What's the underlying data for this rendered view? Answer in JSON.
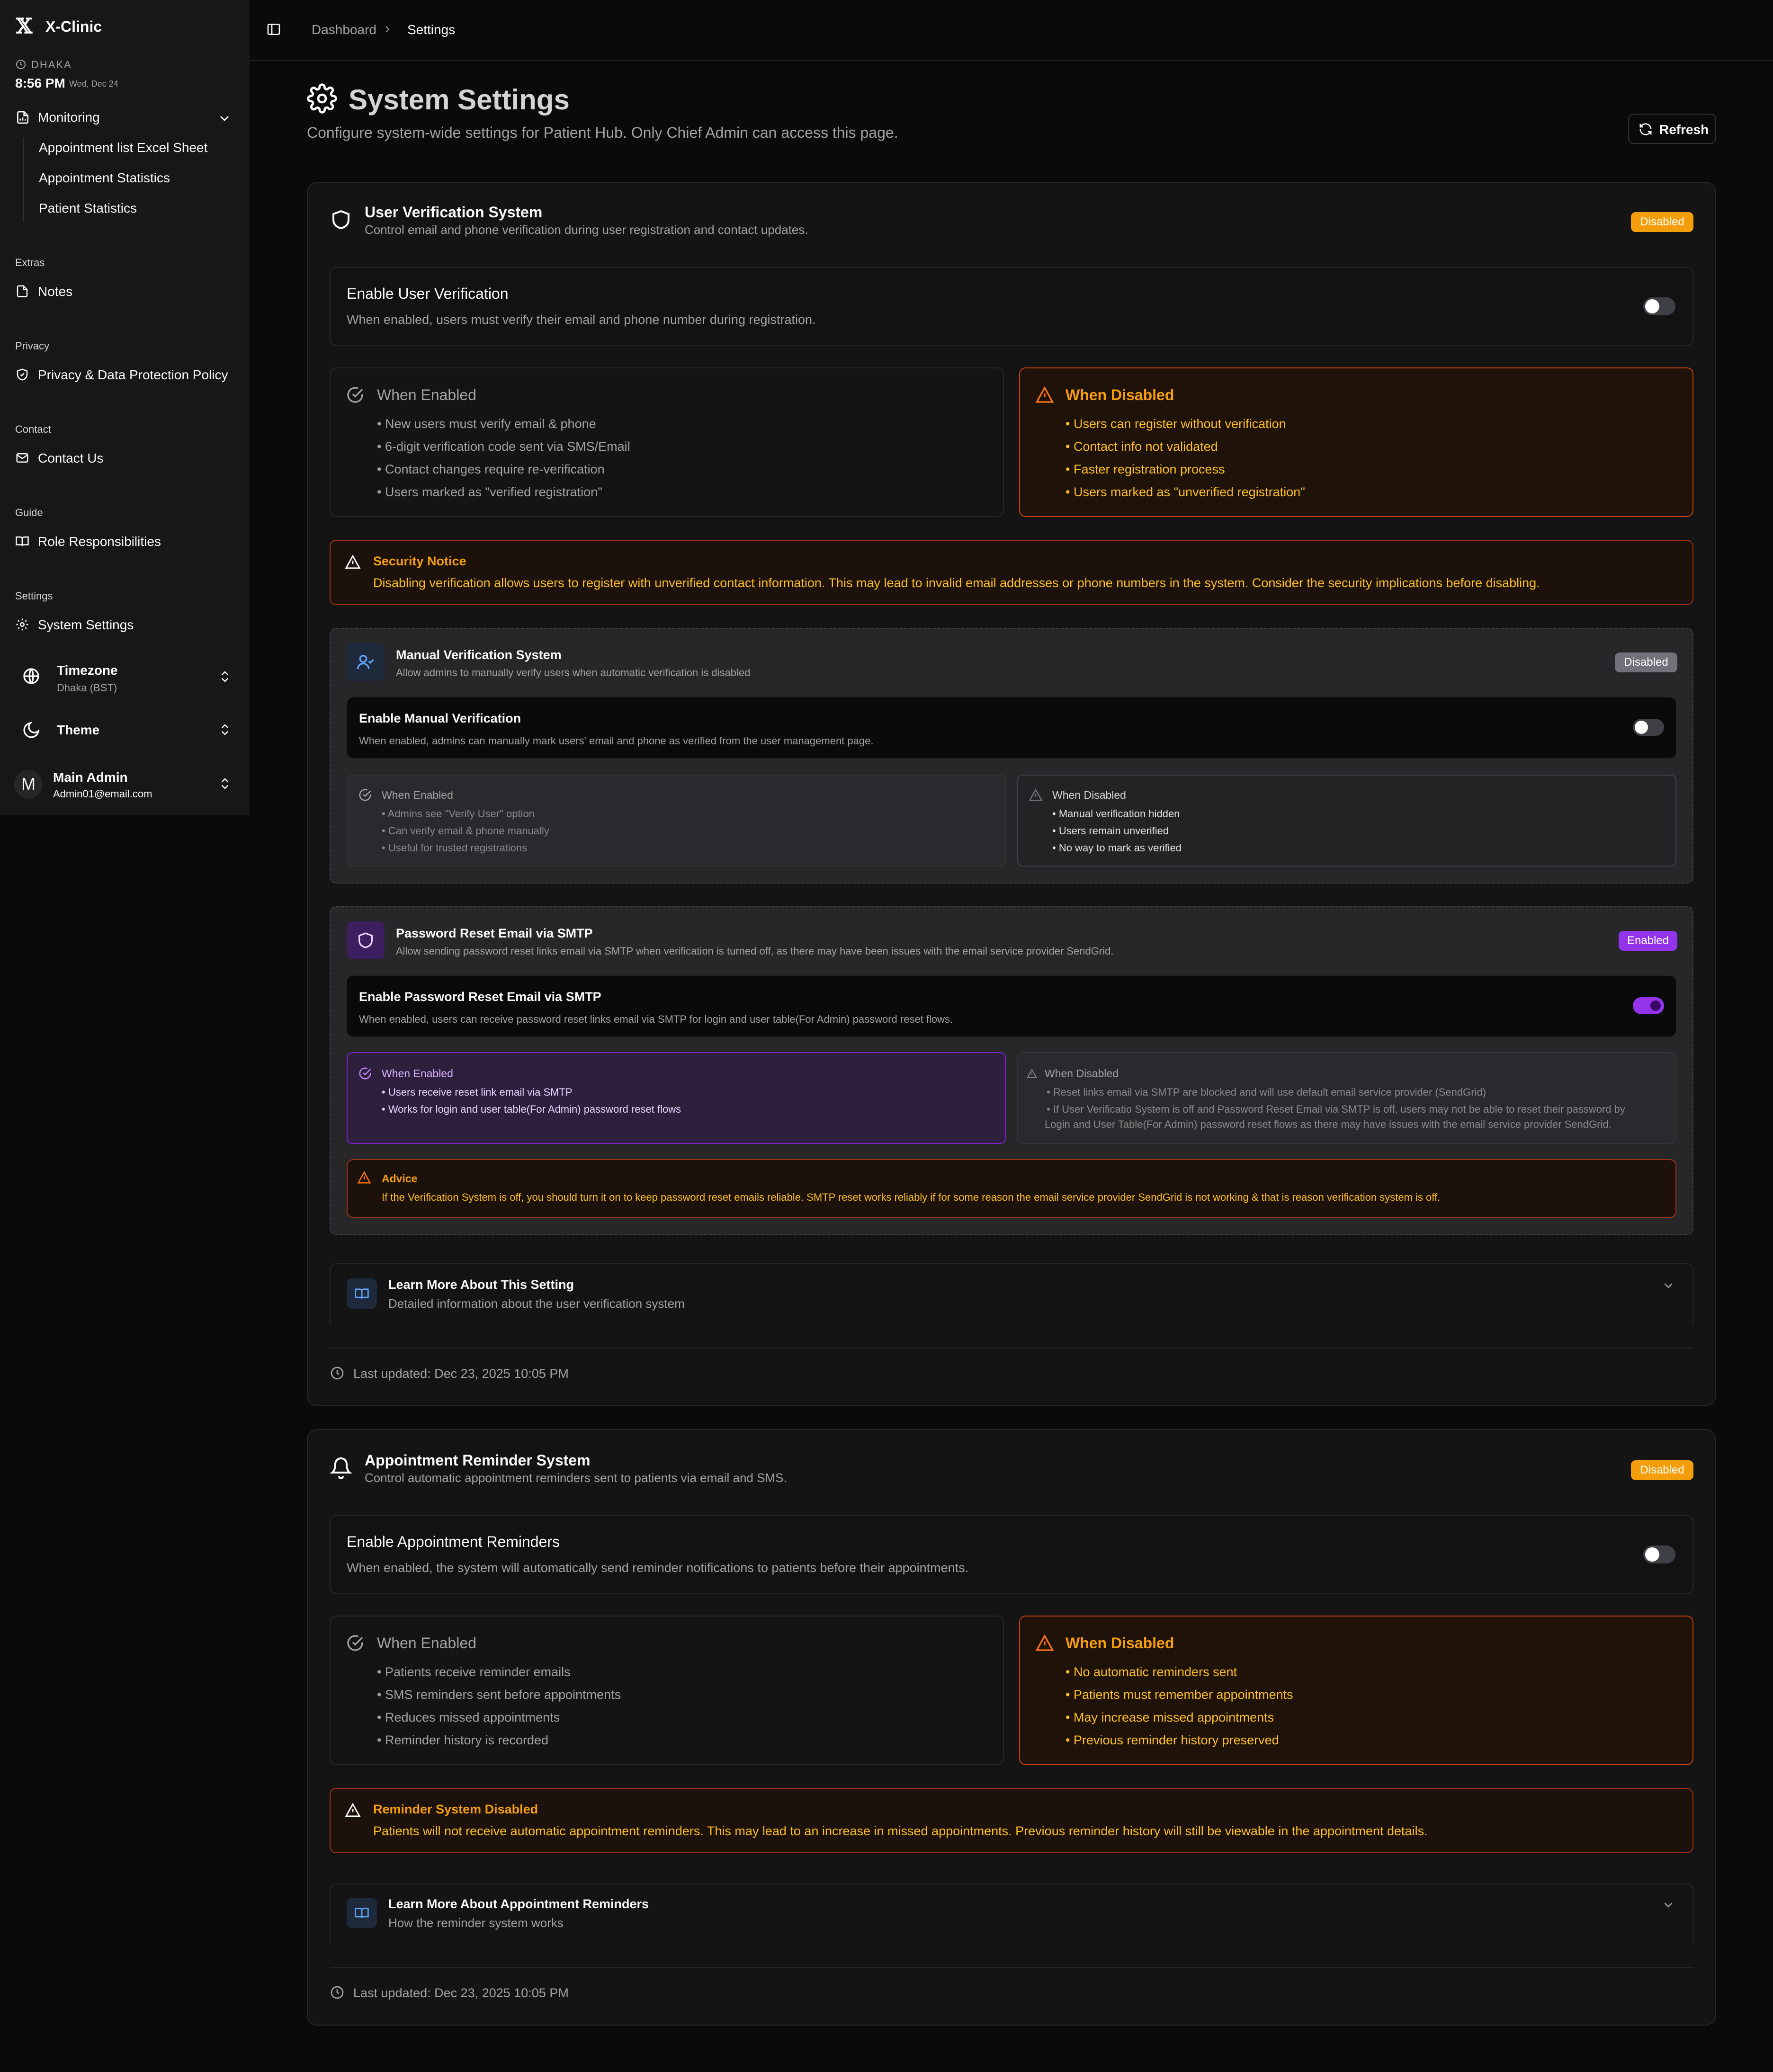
{
  "sidebar": {
    "app_name": "X-Clinic",
    "logo_glyph": "𝕏",
    "clock": {
      "city": "DHAKA",
      "time": "8:56 PM",
      "date": "Wed, Dec 24"
    },
    "monitoring": {
      "label": "Monitoring",
      "items": [
        "Appointment list Excel Sheet",
        "Appointment Statistics",
        "Patient Statistics"
      ]
    },
    "groups": [
      {
        "title": "Extras",
        "item": "Notes"
      },
      {
        "title": "Privacy",
        "item": "Privacy & Data Protection Policy"
      },
      {
        "title": "Contact",
        "item": "Contact Us"
      },
      {
        "title": "Guide",
        "item": "Role Responsibilities"
      },
      {
        "title": "Settings",
        "item": "System Settings"
      }
    ],
    "timezone": {
      "label": "Timezone",
      "value": "Dhaka (BST)"
    },
    "theme": {
      "label": "Theme"
    },
    "user": {
      "avatar": "M",
      "name": "Main Admin",
      "email": "Admin01@email.com"
    }
  },
  "breadcrumb": {
    "parent": "Dashboard",
    "current": "Settings"
  },
  "page": {
    "title": "System Settings",
    "subtitle": "Configure system-wide settings for Patient Hub. Only Chief Admin can access this page.",
    "refresh_label": "Refresh"
  },
  "verification": {
    "title": "User Verification System",
    "subtitle": "Control email and phone verification during user registration and contact updates.",
    "badge": "Disabled",
    "toggle_title": "Enable User Verification",
    "toggle_desc": "When enabled, users must verify their email and phone number during registration.",
    "when_enabled": {
      "title": "When Enabled",
      "items": [
        "• New users must verify email & phone",
        "• 6-digit verification code sent via SMS/Email",
        "• Contact changes require re-verification",
        "• Users marked as \"verified registration\""
      ]
    },
    "when_disabled": {
      "title": "When Disabled",
      "items": [
        "• Users can register without verification",
        "• Contact info not validated",
        "• Faster registration process",
        "• Users marked as \"unverified registration\""
      ]
    },
    "notice": {
      "title": "Security Notice",
      "text": "Disabling verification allows users to register with unverified contact information. This may lead to invalid email addresses or phone numbers in the system. Consider the security implications before disabling."
    },
    "manual": {
      "title": "Manual Verification System",
      "subtitle": "Allow admins to manually verify users when automatic verification is disabled",
      "badge": "Disabled",
      "toggle_title": "Enable Manual Verification",
      "toggle_desc": "When enabled, admins can manually mark users' email and phone as verified from the user management page.",
      "when_enabled": {
        "title": "When Enabled",
        "items": [
          "• Admins see \"Verify User\" option",
          "• Can verify email & phone manually",
          "• Useful for trusted registrations"
        ]
      },
      "when_disabled": {
        "title": "When Disabled",
        "items": [
          "• Manual verification hidden",
          "• Users remain unverified",
          "• No way to mark as verified"
        ]
      }
    },
    "smtp": {
      "title": "Password Reset Email via SMTP",
      "subtitle": "Allow sending password reset links email via SMTP when verification is turned off, as there may have been issues with the email service provider SendGrid.",
      "badge": "Enabled",
      "toggle_title": "Enable Password Reset Email via SMTP",
      "toggle_desc": "When enabled, users can receive password reset links email via SMTP for login and user table(For Admin) password reset flows.",
      "when_enabled": {
        "title": "When Enabled",
        "items": [
          "• Users receive reset link email via SMTP",
          "• Works for login and user table(For Admin) password reset flows"
        ]
      },
      "when_disabled": {
        "title": "When Disabled",
        "items": [
          "• Reset links email via SMTP are blocked and will use default email service provider (SendGrid)",
          "• If User Verificatio System is off and Password Reset Email via SMTP is off, users may not be able to reset their password by",
          "Login and User Table(For Admin) password reset flows as there may have issues with the email service provider SendGrid."
        ]
      },
      "advice": {
        "title": "Advice",
        "text": "If the Verification System is off, you should turn it on to keep password reset emails reliable. SMTP reset works reliably if for some reason the email service provider SendGrid is not working & that is reason verification system is off."
      }
    },
    "learn": {
      "title": "Learn More About This Setting",
      "subtitle": "Detailed information about the user verification system"
    },
    "last_updated": "Last updated: Dec 23, 2025 10:05 PM"
  },
  "reminder": {
    "title": "Appointment Reminder System",
    "subtitle": "Control automatic appointment reminders sent to patients via email and SMS.",
    "badge": "Disabled",
    "toggle_title": "Enable Appointment Reminders",
    "toggle_desc": "When enabled, the system will automatically send reminder notifications to patients before their appointments.",
    "when_enabled": {
      "title": "When Enabled",
      "items": [
        "• Patients receive reminder emails",
        "• SMS reminders sent before appointments",
        "• Reduces missed appointments",
        "• Reminder history is recorded"
      ]
    },
    "when_disabled": {
      "title": "When Disabled",
      "items": [
        "• No automatic reminders sent",
        "• Patients must remember appointments",
        "• May increase missed appointments",
        "• Previous reminder history preserved"
      ]
    },
    "notice": {
      "title": "Reminder System Disabled",
      "text": "Patients will not receive automatic appointment reminders. This may lead to an increase in missed appointments. Previous reminder history will still be viewable in the appointment details."
    },
    "learn": {
      "title": "Learn More About Appointment Reminders",
      "subtitle": "How the reminder system works"
    },
    "last_updated": "Last updated: Dec 23, 2025 10:05 PM"
  },
  "colors": {
    "orange": "#f59e0b",
    "orange_border": "#c2410c",
    "purple": "#9333ea",
    "badge_gray": "#71717a"
  }
}
